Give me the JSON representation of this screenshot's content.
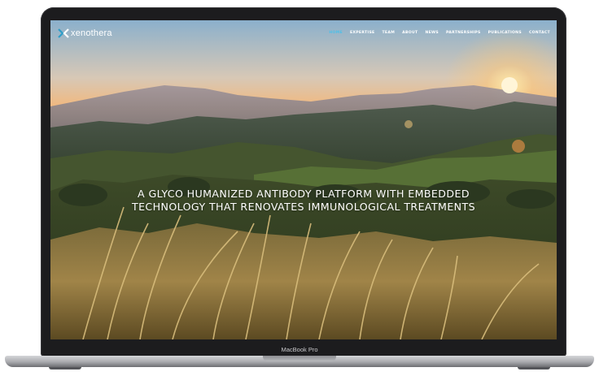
{
  "site": {
    "logo_text": "xenothera",
    "nav": [
      "HOME",
      "EXPERTISE",
      "TEAM",
      "ABOUT",
      "NEWS",
      "PARTNERSHIPS",
      "PUBLICATIONS",
      "CONTACT"
    ],
    "active_nav": "HOME",
    "hero_lines": [
      "A GLYCO HUMANIZED ANTIBODY PLATFORM WITH EMBEDDED",
      "TECHNOLOGY THAT RENOVATES IMMUNOLOGICAL TREATMENTS"
    ]
  },
  "device": {
    "label": "MacBook Pro"
  },
  "colors": {
    "active_nav": "#4fc0e8",
    "nav_text": "#ffffff",
    "logo_accent": "#2f9ec8"
  },
  "icons": {
    "logo": "xenothera-logo-mark"
  }
}
